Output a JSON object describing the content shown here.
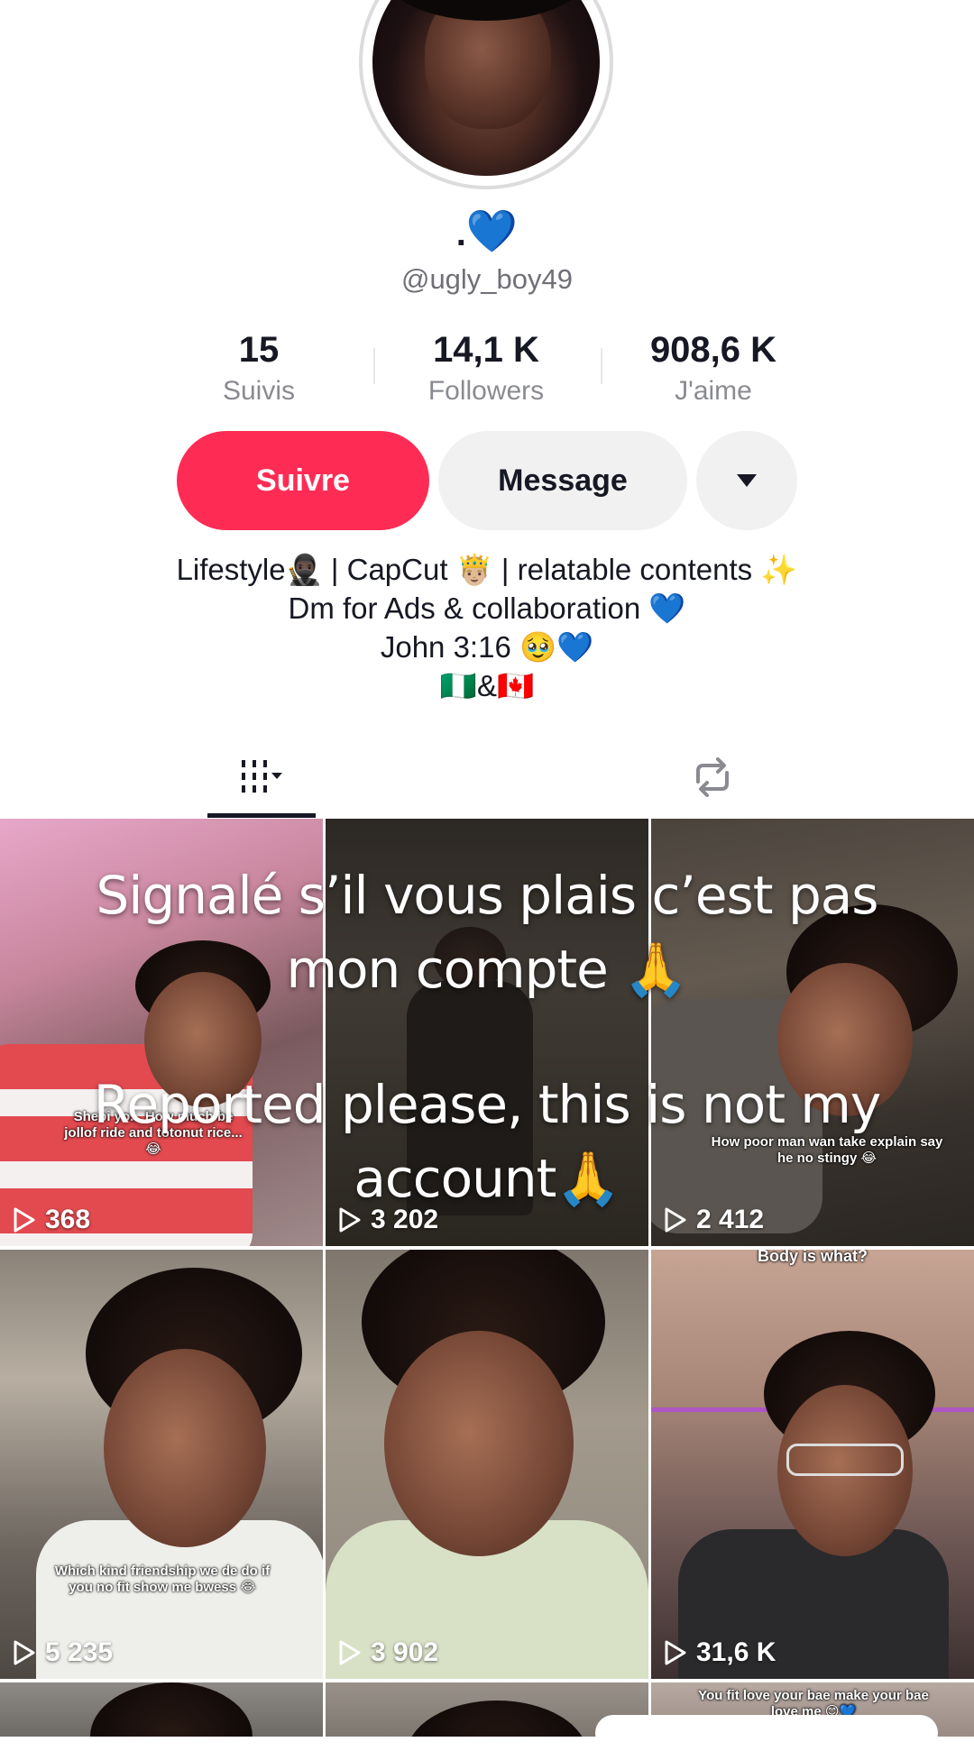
{
  "profile": {
    "display_name_dot": ".",
    "display_name_emoji": "💙",
    "username": "@ugly_boy49"
  },
  "stats": {
    "following": {
      "value": "15",
      "label": "Suivis"
    },
    "followers": {
      "value": "14,1 K",
      "label": "Followers"
    },
    "likes": {
      "value": "908,6 K",
      "label": "J'aime"
    }
  },
  "actions": {
    "follow_label": "Suivre",
    "message_label": "Message",
    "more_icon": "caret-down-icon"
  },
  "bio": {
    "line1": "Lifestyle🥷🏿 | CapCut 🤴🏼 | relatable contents ✨",
    "line2": "Dm for Ads & collaboration 💙",
    "line3": "John 3:16 🥹💙",
    "line4": "🇳🇬&🇨🇦"
  },
  "tabs": {
    "videos_icon": "grid-videos-icon",
    "reposts_icon": "repost-icon"
  },
  "videos": [
    {
      "views": "368",
      "caption": "Shebi yo... How much be jollof ride and totonut rice... 😂"
    },
    {
      "views": "3 202",
      "caption": ""
    },
    {
      "views": "2 412",
      "caption": "How poor man wan take explain say he no stingy 😂"
    },
    {
      "views": "5 235",
      "caption": "Which kind friendship we de do if you no fit show me bwess 😂"
    },
    {
      "views": "3 902",
      "caption": ""
    },
    {
      "views": "31,6 K",
      "caption": "Body is what?"
    },
    {
      "views": "",
      "caption": ""
    },
    {
      "views": "",
      "caption": ""
    },
    {
      "views": "",
      "caption": "You fit love your bae make your bae love me 😊💙"
    }
  ],
  "overlay": {
    "french_line1": "Signalé s’il vous plais c’est pas",
    "french_line2": "mon compte 🙏",
    "english_line1": "Reported please, this is not my",
    "english_line2": "account🙏"
  },
  "colors": {
    "follow_button": "#fe2c55",
    "secondary_button": "#f1f1f2",
    "heart": "#1e7bf2"
  }
}
